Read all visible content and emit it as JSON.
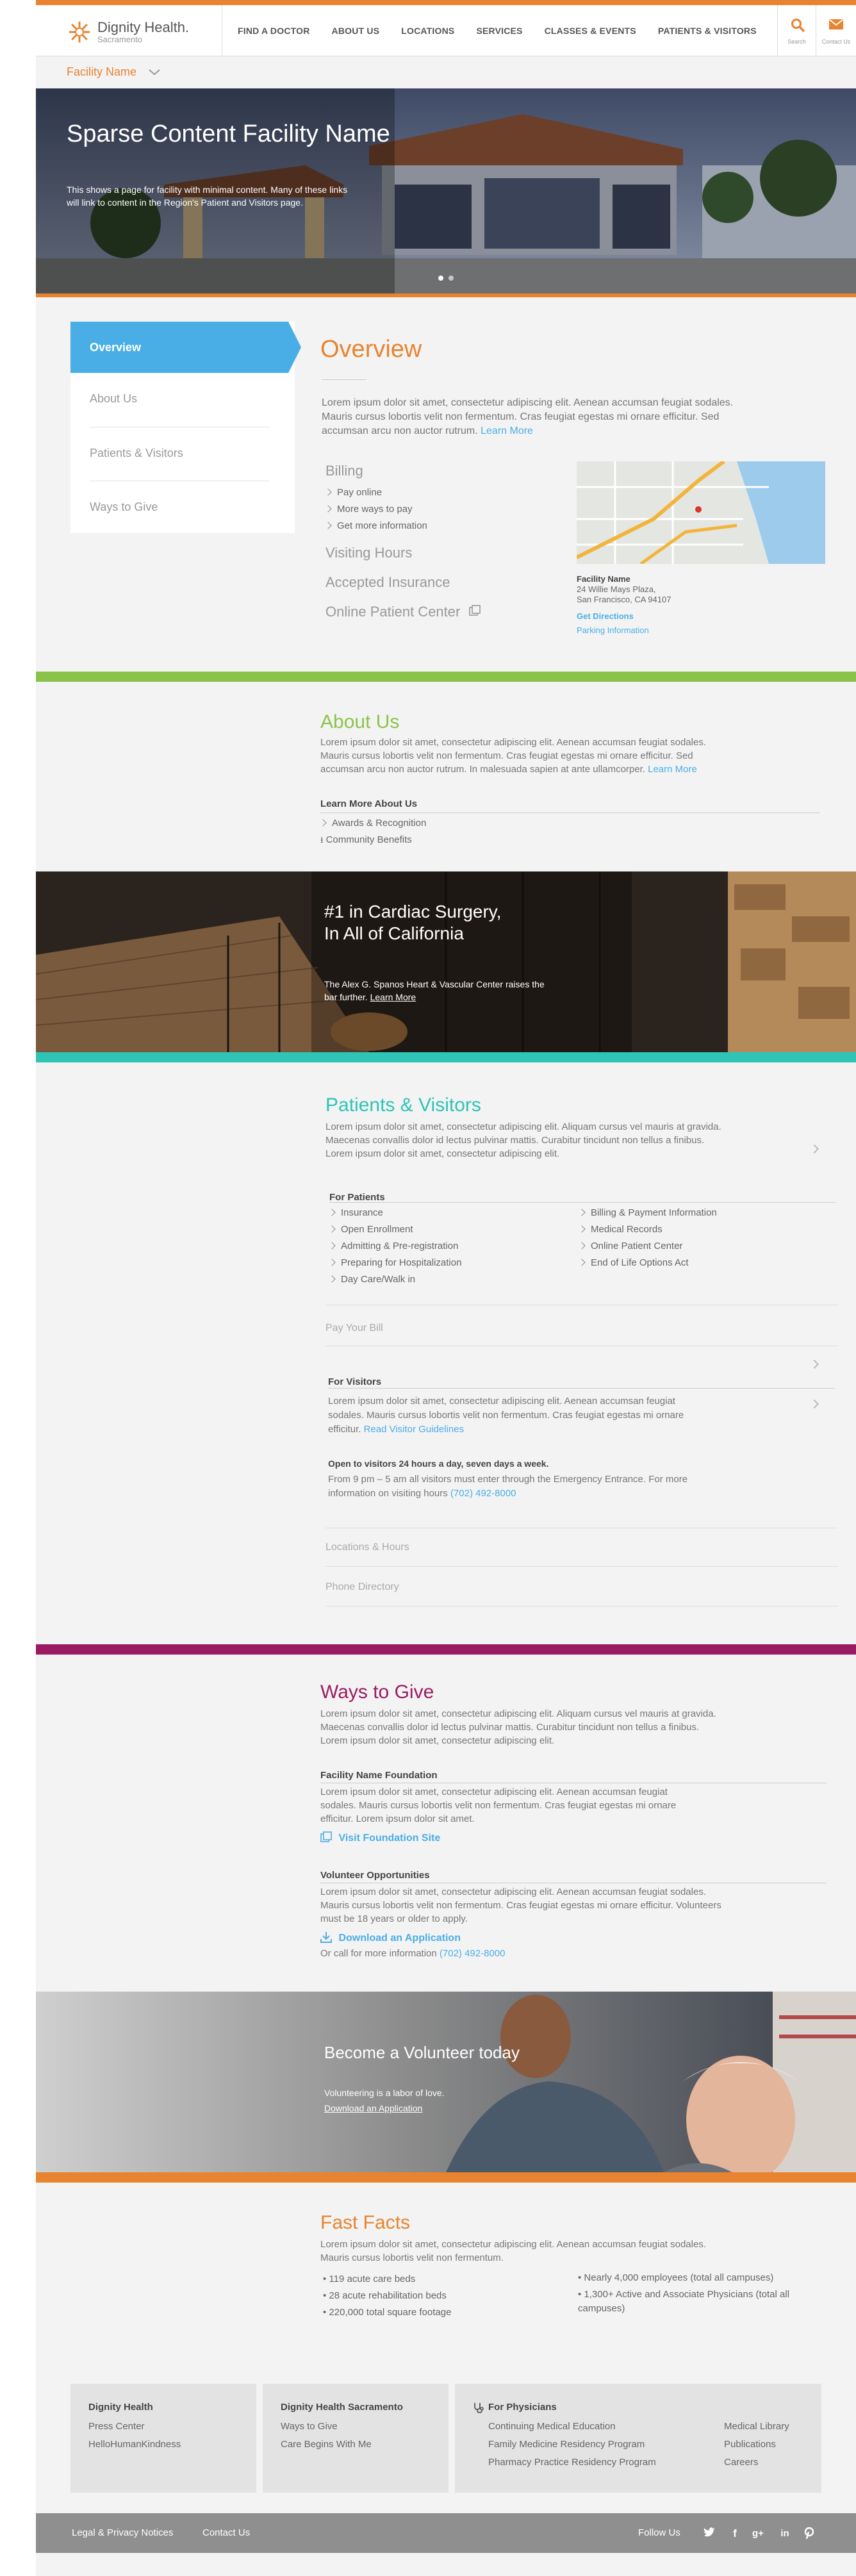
{
  "header": {
    "brand": "Dignity Health.",
    "brand_sub": "Sacramento",
    "nav": [
      "FIND A DOCTOR",
      "ABOUT US",
      "LOCATIONS",
      "SERVICES",
      "CLASSES & EVENTS",
      "PATIENTS & VISITORS"
    ],
    "search_label": "Search",
    "contact_label": "Contact Us",
    "accent_color": "#e8832f"
  },
  "subnav": {
    "title": "Facility Name"
  },
  "hero": {
    "title": "Sparse Content Facility Name",
    "text": "This shows a page for facility with minimal content. Many of these links will link to content in the Region's Patient and Visitors page."
  },
  "sidemenu": {
    "active": "Overview",
    "items": [
      "About Us",
      "Patients & Visitors",
      "Ways to Give"
    ],
    "active_color": "#4aaee6"
  },
  "overview": {
    "title": "Overview",
    "text": "Lorem ipsum dolor sit amet, consectetur adipiscing elit. Aenean accumsan feugiat sodales. Mauris cursus lobortis velit non fermentum. Cras feugiat egestas mi ornare efficitur. Sed accumsan arcu non auctor rutrum.",
    "learn_more": "Learn More",
    "billing_title": "Billing",
    "billing_links": [
      "Pay online",
      "More ways to pay",
      "Get more information"
    ],
    "visiting_hours": "Visiting Hours",
    "accepted_insurance": "Accepted Insurance",
    "online_patient_center": "Online Patient Center",
    "facility_label": "Facility Name",
    "address1": "24 Willie Mays Plaza,",
    "address2": "San Francisco, CA 94107",
    "get_directions": "Get Directions",
    "parking": "Parking Information"
  },
  "about": {
    "title": "About Us",
    "text": "Lorem ipsum dolor sit amet, consectetur adipiscing elit. Aenean accumsan feugiat sodales. Mauris cursus lobortis velit non fermentum. Cras feugiat egestas mi ornare efficitur. Sed accumsan arcu non auctor rutrum. In malesuada sapien at ante ullamcorper.",
    "learn_more": "Learn More",
    "learn_more_title": "Learn More About Us",
    "links": [
      "Awards & Recognition",
      "Community Benefits"
    ],
    "color": "#8bc34a"
  },
  "cardiac": {
    "title_line1": "#1 in Cardiac Surgery,",
    "title_line2": "In All of California",
    "text": "The Alex G. Spanos Heart & Vascular Center raises the bar further.",
    "link": "Learn More"
  },
  "patients": {
    "title": "Patients & Visitors",
    "text": "Lorem ipsum dolor sit amet, consectetur adipiscing elit. Aliquam cursus vel mauris at gravida. Maecenas convallis dolor id lectus pulvinar mattis. Curabitur tincidunt non tellus a finibus. Lorem ipsum dolor sit amet, consectetur adipiscing elit.",
    "for_patients": "For Patients",
    "col1": [
      "Insurance",
      "Open Enrollment",
      "Admitting & Pre-registration",
      "Preparing for Hospitalization",
      "Day Care/Walk in"
    ],
    "col2": [
      "Billing & Payment Information",
      "Medical Records",
      "Online Patient Center",
      "End of Life Options Act"
    ],
    "pay_your_bill": "Pay Your Bill",
    "for_visitors": "For Visitors",
    "visitors_text": "Lorem ipsum dolor sit amet, consectetur adipiscing elit. Aenean accumsan feugiat sodales. Mauris cursus lobortis velit non fermentum. Cras feugiat egestas mi ornare efficitur.",
    "visitor_guidelines": "Read Visitor Guidelines",
    "open_hours": "Open to visitors 24 hours a day, seven days a week.",
    "hours_text": "From 9 pm – 5 am all visitors must enter through the Emergency Entrance. For more information on visiting hours",
    "phone": "(702) 492-8000",
    "locations_hours": "Locations & Hours",
    "phone_directory": "Phone Directory",
    "color": "#2ec4b6"
  },
  "ways": {
    "title": "Ways to Give",
    "text": "Lorem ipsum dolor sit amet, consectetur adipiscing elit. Aliquam cursus vel mauris at gravida. Maecenas convallis dolor id lectus pulvinar mattis. Curabitur tincidunt non tellus a finibus. Lorem ipsum dolor sit amet, consectetur adipiscing elit.",
    "foundation_title": "Facility Name Foundation",
    "foundation_text": "Lorem ipsum dolor sit amet, consectetur adipiscing elit. Aenean accumsan feugiat sodales. Mauris cursus lobortis velit non fermentum. Cras feugiat egestas mi ornare efficitur. Lorem ipsum dolor sit amet.",
    "visit_site": "Visit Foundation Site",
    "volunteer_title": "Volunteer Opportunities",
    "volunteer_text": "Lorem ipsum dolor sit amet, consectetur adipiscing elit. Aenean accumsan feugiat sodales. Mauris cursus lobortis velit non fermentum. Cras feugiat egestas mi ornare efficitur. Volunteers must be 18 years or older to apply.",
    "download": "Download an Application",
    "call_text": "Or call for more information",
    "phone": "(702) 492-8000",
    "color": "#9b1b63"
  },
  "volunteer_banner": {
    "title": "Become a Volunteer today",
    "text": "Volunteering is a labor of love.",
    "link": "Download an Application"
  },
  "facts": {
    "title": "Fast Facts",
    "text": "Lorem ipsum dolor sit amet, consectetur adipiscing elit. Aenean accumsan feugiat sodales. Mauris cursus lobortis velit non fermentum.",
    "col1": [
      "119 acute care beds",
      "28 acute rehabilitation beds",
      "220,000 total square footage"
    ],
    "col2": [
      "Nearly 4,000 employees (total all campuses)",
      "1,300+ Active and Associate Physicians (total all campuses)"
    ]
  },
  "footer": {
    "box1_title": "Dignity Health",
    "box1_links": [
      "Press Center",
      "HelloHumanKindness"
    ],
    "box2_title": "Dignity Health Sacramento",
    "box2_links": [
      "Ways to Give",
      "Care Begins With Me"
    ],
    "box3_title": "For Physicians",
    "box3_col1": [
      "Continuing Medical Education",
      "Family Medicine Residency Program",
      "Pharmacy Practice Residency Program"
    ],
    "box3_col2": [
      "Medical Library",
      "Publications",
      "Careers"
    ],
    "legal": "Legal & Privacy Notices",
    "contact": "Contact Us",
    "follow": "Follow Us",
    "social": [
      "twitter-icon",
      "facebook-icon",
      "google-plus-icon",
      "linkedin-icon",
      "pinterest-icon"
    ]
  }
}
